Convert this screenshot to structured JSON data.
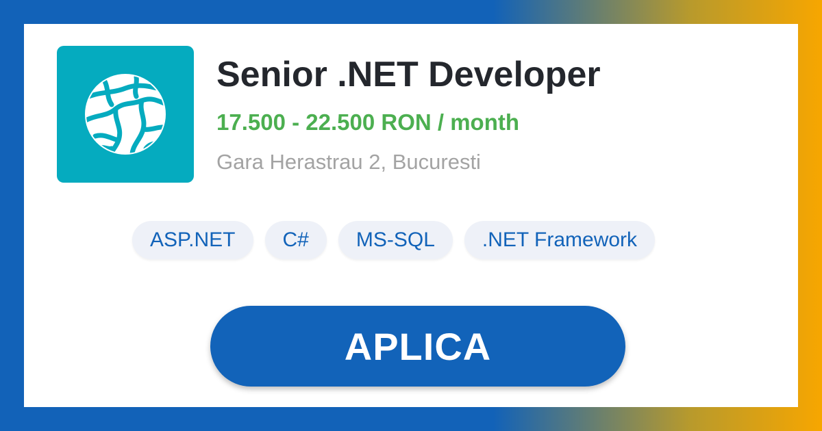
{
  "job": {
    "title": "Senior .NET Developer",
    "salary": "17.500 - 22.500 RON / month",
    "location": "Gara Herastrau 2, Bucuresti",
    "tags": [
      "ASP.NET",
      "C#",
      "MS-SQL",
      ".NET Framework"
    ]
  },
  "company": {
    "logo_icon": "globe-logo-icon"
  },
  "actions": {
    "apply_label": "APLICA"
  },
  "colors": {
    "brand_blue": "#1263b9",
    "salary_green": "#4caf50",
    "logo_teal": "#05abbf",
    "accent_orange": "#f7a600"
  }
}
